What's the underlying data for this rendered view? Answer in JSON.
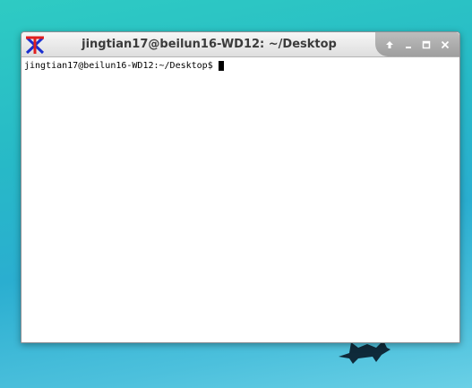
{
  "desktop": {
    "background_top": "#2ecbc3",
    "background_bottom": "#6ad0e6"
  },
  "window": {
    "title": "jingtian17@beilun16-WD12: ~/Desktop",
    "app_icon": "xterm-icon",
    "controls": {
      "shade_icon": "arrow-up-icon",
      "minimize_icon": "minimize-icon",
      "maximize_icon": "maximize-icon",
      "close_icon": "close-icon"
    }
  },
  "terminal": {
    "prompt": "jingtian17@beilun16-WD12:~/Desktop$",
    "input": ""
  }
}
